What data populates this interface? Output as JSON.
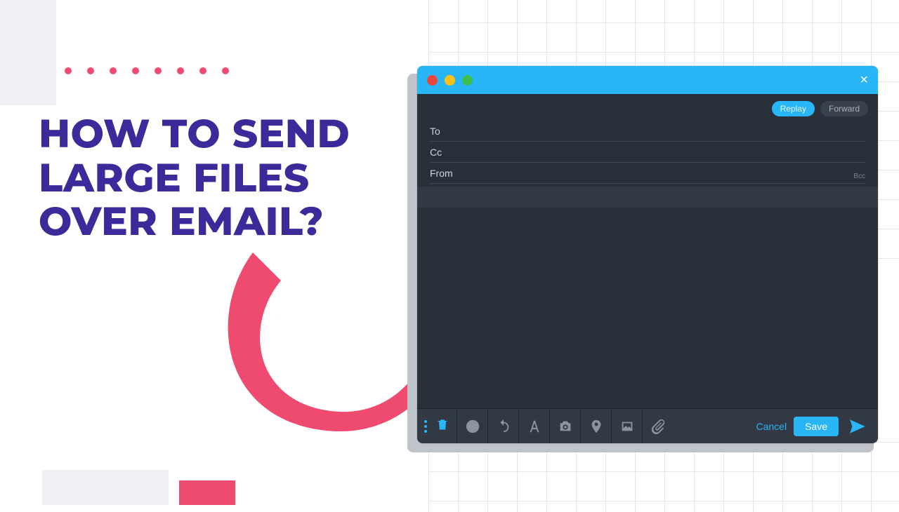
{
  "headline": "HOW TO SEND LARGE FILES OVER EMAIL?",
  "compose": {
    "pills": {
      "replay": "Replay",
      "forward": "Forward"
    },
    "fields": {
      "to": "To",
      "cc": "Cc",
      "from": "From",
      "bcc": "Bcc"
    },
    "actions": {
      "cancel": "Cancel",
      "save": "Save"
    }
  },
  "colors": {
    "accent": "#29b6f6",
    "pink": "#ef4a6f",
    "headline": "#3b2a9a"
  }
}
